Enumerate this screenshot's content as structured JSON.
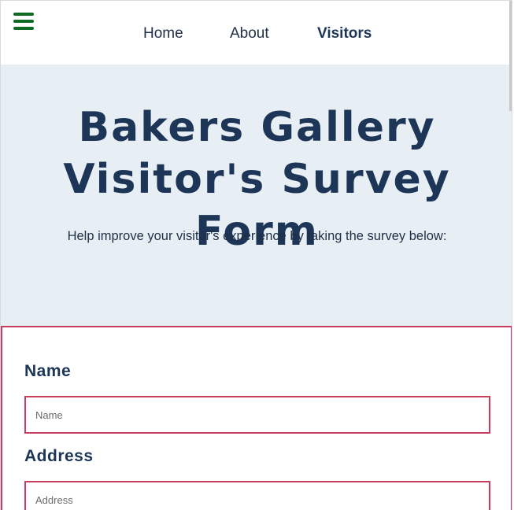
{
  "nav": {
    "home_label": "Home",
    "about_label": "About",
    "visitors_label": "Visitors",
    "menu_icon": "hamburger-menu-icon"
  },
  "hero": {
    "title": "Bakers Gallery Visitor's Survey Form",
    "subtitle": "Help improve your visitor's experience by taking the survey below:"
  },
  "form": {
    "name_label": "Name",
    "name_placeholder": "Name",
    "name_value": "",
    "address_label": "Address",
    "address_placeholder": "Address",
    "address_value": ""
  },
  "colors": {
    "accent_border": "#c63d5e",
    "heading": "#1d3557",
    "hero_background": "#e7eef4",
    "menu_icon": "#0f6b24"
  }
}
